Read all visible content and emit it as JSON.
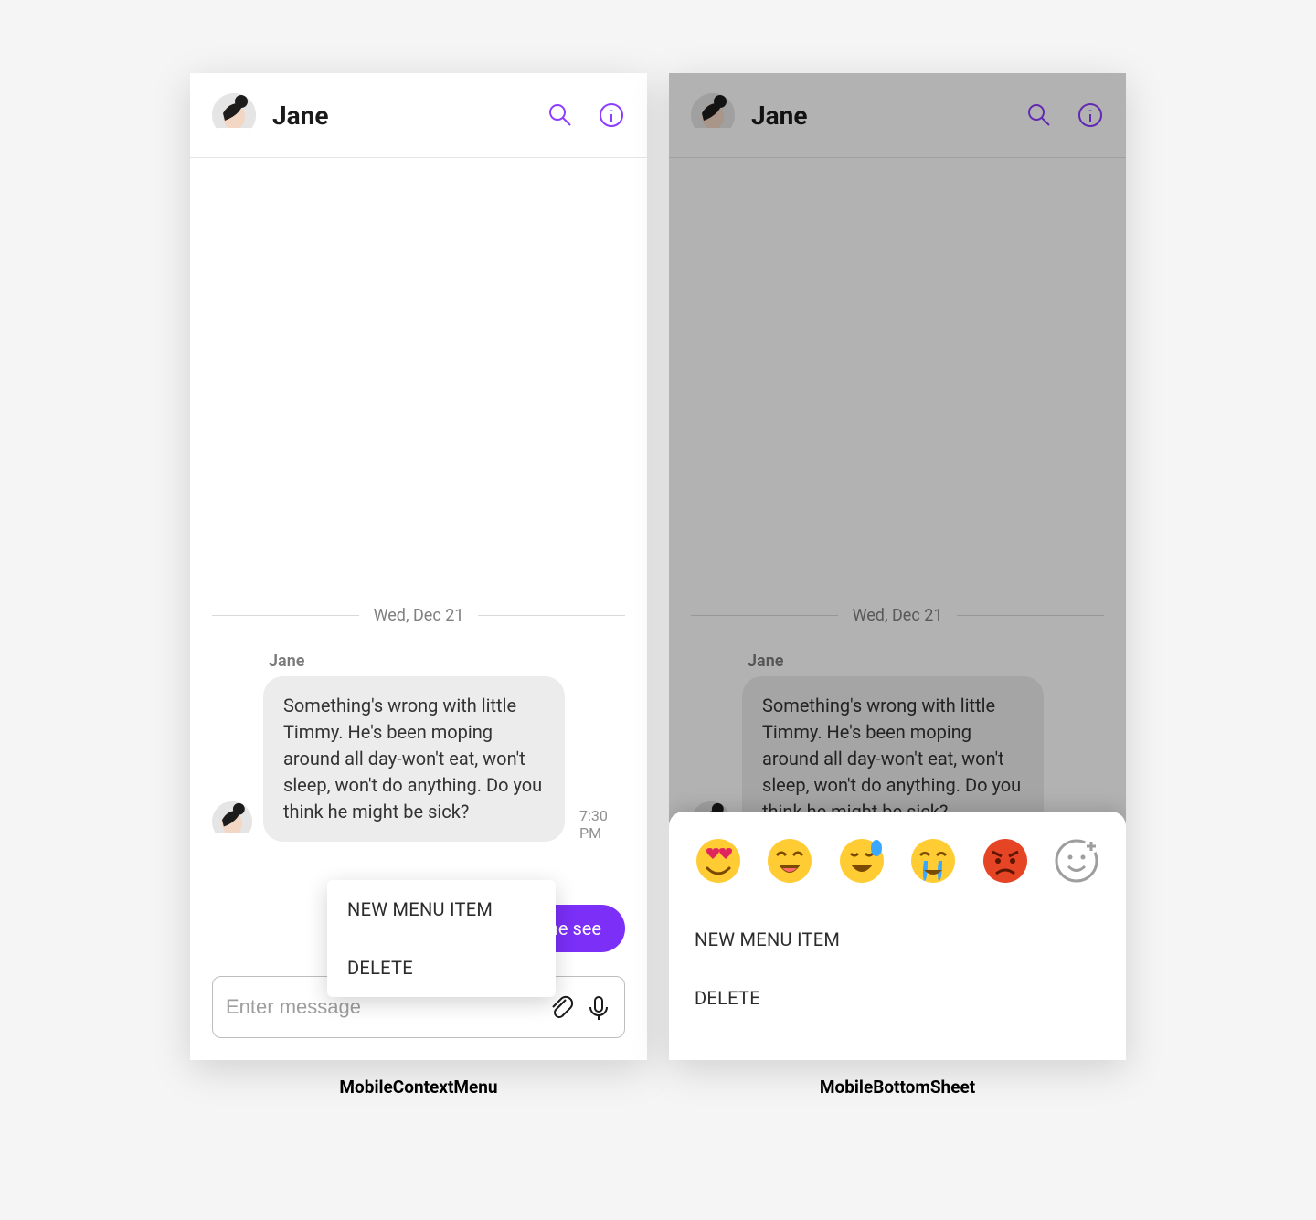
{
  "colors": {
    "accent": "#7b2ff7"
  },
  "header": {
    "title": "Jane"
  },
  "chat": {
    "date_label": "Wed, Dec 21",
    "sender": "Jane",
    "message": "Something's wrong with little Timmy. He's been moping around all day-won't eat, won't sleep, won't do anything. Do you think he might be sick?",
    "time": "7:30 PM",
    "reply_text": "Let me see"
  },
  "context_menu": {
    "items": [
      "NEW MENU ITEM",
      "DELETE"
    ]
  },
  "composer": {
    "placeholder": "Enter message"
  },
  "bottom_sheet": {
    "reactions": [
      "heart-eyes",
      "laughing",
      "sweat-smile",
      "crying",
      "angry",
      "add-reaction"
    ],
    "items": [
      "NEW MENU ITEM",
      "DELETE"
    ]
  },
  "captions": {
    "left": "MobileContextMenu",
    "right": "MobileBottomSheet"
  }
}
